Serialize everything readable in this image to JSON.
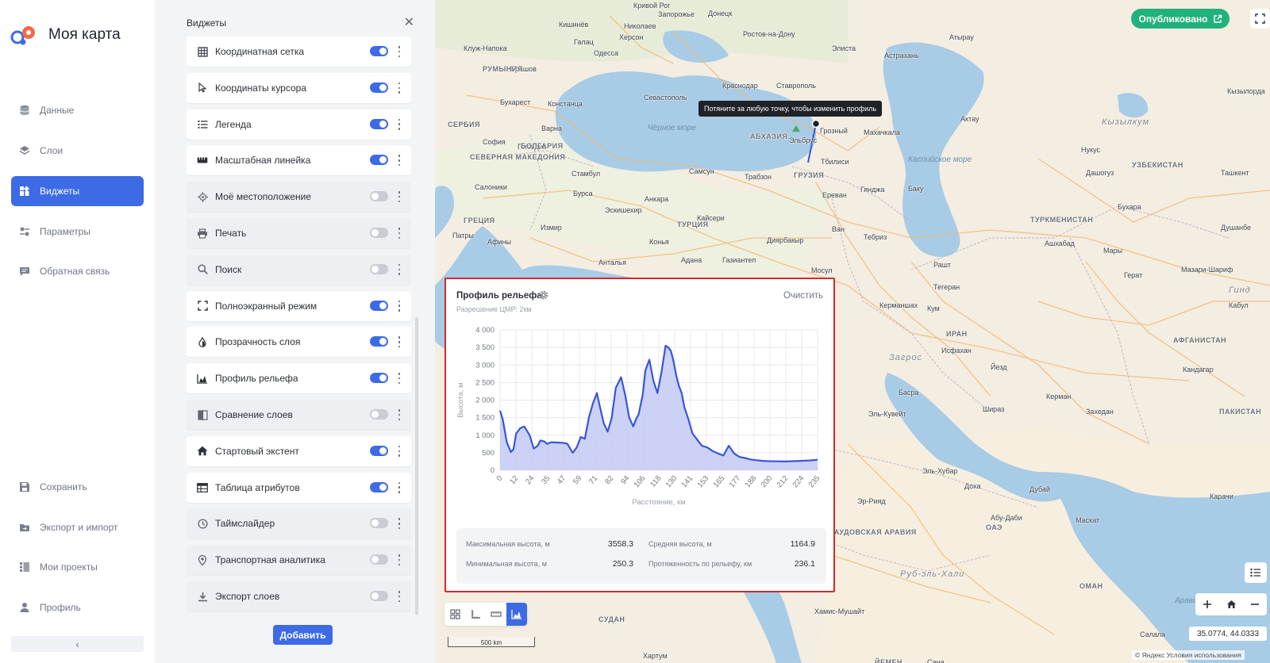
{
  "app": {
    "title": "Моя карта"
  },
  "nav": {
    "items": [
      {
        "label": "Данные",
        "icon": "database-icon"
      },
      {
        "label": "Слои",
        "icon": "layers-icon"
      },
      {
        "label": "Виджеты",
        "icon": "widgets-icon",
        "active": true
      },
      {
        "label": "Параметры",
        "icon": "settings-icon"
      },
      {
        "label": "Обратная связь",
        "icon": "feedback-icon"
      }
    ],
    "bottom": [
      {
        "label": "Сохранить",
        "icon": "save-icon"
      },
      {
        "label": "Экспорт и импорт",
        "icon": "folder-export-icon"
      },
      {
        "label": "Мои проекты",
        "icon": "projects-icon"
      },
      {
        "label": "Профиль",
        "icon": "user-icon"
      }
    ],
    "collapse": "‹"
  },
  "panel": {
    "title": "Виджеты",
    "close": "✕",
    "add_label": "Добавить",
    "widgets": [
      {
        "label": "Координатная сетка",
        "icon": "grid-icon",
        "enabled": true
      },
      {
        "label": "Координаты курсора",
        "icon": "cursor-icon",
        "enabled": true
      },
      {
        "label": "Легенда",
        "icon": "list-icon",
        "enabled": true
      },
      {
        "label": "Масштабная линейка",
        "icon": "ruler-icon",
        "enabled": true
      },
      {
        "label": "Моё местоположение",
        "icon": "location-target-icon",
        "enabled": false
      },
      {
        "label": "Печать",
        "icon": "printer-icon",
        "enabled": false
      },
      {
        "label": "Поиск",
        "icon": "search-icon",
        "enabled": false
      },
      {
        "label": "Полноэкранный режим",
        "icon": "fullscreen-icon",
        "enabled": true
      },
      {
        "label": "Прозрачность слоя",
        "icon": "drop-icon",
        "enabled": true
      },
      {
        "label": "Профиль рельефа",
        "icon": "area-chart-icon",
        "enabled": true
      },
      {
        "label": "Сравнение слоев",
        "icon": "compare-icon",
        "enabled": false
      },
      {
        "label": "Стартовый экстент",
        "icon": "home-icon",
        "enabled": true
      },
      {
        "label": "Таблица атрибутов",
        "icon": "table-icon",
        "enabled": true
      },
      {
        "label": "Таймслайдер",
        "icon": "clock-icon",
        "enabled": false
      },
      {
        "label": "Транспортная аналитика",
        "icon": "pin-icon",
        "enabled": false
      },
      {
        "label": "Экспорт слоев",
        "icon": "download-icon",
        "enabled": false
      }
    ]
  },
  "map": {
    "published_label": "Опубликовано",
    "tooltip": "Потяните за любую точку, чтобы изменить профиль",
    "coords": "35.0774, 44.0333",
    "attribution": "© Яндекс Условия использования",
    "scale_label": "500 km",
    "labels": [
      {
        "t": "Запорожье",
        "c": "city"
      },
      {
        "t": "Донецк",
        "c": "city"
      },
      {
        "t": "Ростов-на-Дону",
        "c": "city"
      },
      {
        "t": "Херсон",
        "c": "city"
      },
      {
        "t": "Кишинёв",
        "c": "city"
      },
      {
        "t": "Одесса",
        "c": "city"
      },
      {
        "t": "Николаев",
        "c": "city"
      },
      {
        "t": "Кривой Рог",
        "c": "city"
      },
      {
        "t": "Элиста",
        "c": "city"
      },
      {
        "t": "Астрахань",
        "c": "city"
      },
      {
        "t": "Атырау",
        "c": "city"
      },
      {
        "t": "Клуж-Напока",
        "c": "city"
      },
      {
        "t": "Брашов",
        "c": "city"
      },
      {
        "t": "Галац",
        "c": "city"
      },
      {
        "t": "Констанца",
        "c": "city"
      },
      {
        "t": "Бухарест",
        "c": "city"
      },
      {
        "t": "Варна",
        "c": "city"
      },
      {
        "t": "Севастополь",
        "c": "city"
      },
      {
        "t": "Краснодар",
        "c": "city"
      },
      {
        "t": "Ставрополь",
        "c": "city"
      },
      {
        "t": "Грозный",
        "c": "city"
      },
      {
        "t": "Махачкала",
        "c": "city"
      },
      {
        "t": "Эльбрус",
        "c": "city"
      },
      {
        "t": "Тбилиси",
        "c": "city"
      },
      {
        "t": "Ереван",
        "c": "city"
      },
      {
        "t": "Баку",
        "c": "city"
      },
      {
        "t": "Гянджа",
        "c": "city"
      },
      {
        "t": "Самсун",
        "c": "city"
      },
      {
        "t": "Трабзон",
        "c": "city"
      },
      {
        "t": "Стамбул",
        "c": "city"
      },
      {
        "t": "Бурса",
        "c": "city"
      },
      {
        "t": "Анкара",
        "c": "city"
      },
      {
        "t": "Кайсери",
        "c": "city"
      },
      {
        "t": "Измир",
        "c": "city"
      },
      {
        "t": "Конья",
        "c": "city"
      },
      {
        "t": "Диярбакыр",
        "c": "city"
      },
      {
        "t": "Ван",
        "c": "city"
      },
      {
        "t": "Тебриз",
        "c": "city"
      },
      {
        "t": "Анталья",
        "c": "city"
      },
      {
        "t": "Адана",
        "c": "city"
      },
      {
        "t": "Газиантеп",
        "c": "city"
      },
      {
        "t": "Мосул",
        "c": "city"
      },
      {
        "t": "София",
        "c": "city"
      },
      {
        "t": "Салоники",
        "c": "city"
      },
      {
        "t": "Афины",
        "c": "city"
      },
      {
        "t": "Патры",
        "c": "city"
      },
      {
        "t": "Эскишехир",
        "c": "city"
      },
      {
        "t": "Пловдив",
        "c": "city"
      },
      {
        "t": "Рашт",
        "c": "city"
      },
      {
        "t": "Тегеран",
        "c": "city"
      },
      {
        "t": "Кум",
        "c": "city"
      },
      {
        "t": "Керманшах",
        "c": "city"
      },
      {
        "t": "Исфахан",
        "c": "city"
      },
      {
        "t": "Йезд",
        "c": "city"
      },
      {
        "t": "Шираз",
        "c": "city"
      },
      {
        "t": "Керман",
        "c": "city"
      },
      {
        "t": "Басра",
        "c": "city"
      },
      {
        "t": "Эль-Кувейт",
        "c": "city"
      },
      {
        "t": "Эль-Хубар",
        "c": "city"
      },
      {
        "t": "Доха",
        "c": "city"
      },
      {
        "t": "Эр-Рияд",
        "c": "city"
      },
      {
        "t": "Дубай",
        "c": "city"
      },
      {
        "t": "Абу-Даби",
        "c": "city"
      },
      {
        "t": "Маскат",
        "c": "city"
      },
      {
        "t": "Захедан",
        "c": "city"
      },
      {
        "t": "Кандагар",
        "c": "city"
      },
      {
        "t": "Карачи",
        "c": "city"
      },
      {
        "t": "Ашхабад",
        "c": "city"
      },
      {
        "t": "Мары",
        "c": "city"
      },
      {
        "t": "Герат",
        "c": "city"
      },
      {
        "t": "Мазари-Шариф",
        "c": "city"
      },
      {
        "t": "Кабул",
        "c": "city"
      },
      {
        "t": "Бухара",
        "c": "city"
      },
      {
        "t": "Нукус",
        "c": "city"
      },
      {
        "t": "Дашогуз",
        "c": "city"
      },
      {
        "t": "Ташкент",
        "c": "city"
      },
      {
        "t": "Кызылорда",
        "c": "city"
      },
      {
        "t": "Актау",
        "c": "city"
      },
      {
        "t": "Душанбе",
        "c": "city"
      },
      {
        "t": "Сана",
        "c": "city"
      },
      {
        "t": "Хартум",
        "c": "city"
      },
      {
        "t": "Салала",
        "c": "city"
      },
      {
        "t": "Хамис-Мушайт",
        "c": "city"
      },
      {
        "t": "СЕРБИЯ",
        "c": "country"
      },
      {
        "t": "БОЛГАРИЯ",
        "c": "country"
      },
      {
        "t": "РУМЫНИЯ",
        "c": "country"
      },
      {
        "t": "СЕВЕРНАЯ МАКЕДОНИЯ",
        "c": "country"
      },
      {
        "t": "ГРЕЦИЯ",
        "c": "country"
      },
      {
        "t": "ТУРЦИЯ",
        "c": "country"
      },
      {
        "t": "АБХАЗИЯ",
        "c": "country"
      },
      {
        "t": "ГРУЗИЯ",
        "c": "country"
      },
      {
        "t": "ИРАН",
        "c": "country"
      },
      {
        "t": "ТУРКМЕНИСТАН",
        "c": "country"
      },
      {
        "t": "УЗБЕКИСТАН",
        "c": "country"
      },
      {
        "t": "АФГАНИСТАН",
        "c": "country"
      },
      {
        "t": "ПАКИСТАН",
        "c": "country"
      },
      {
        "t": "САУДОВСКАЯ АРАВИЯ",
        "c": "country"
      },
      {
        "t": "ОАЭ",
        "c": "country"
      },
      {
        "t": "ОМАН",
        "c": "country"
      },
      {
        "t": "СУДАН",
        "c": "country"
      },
      {
        "t": "ЙЕМЕН",
        "c": "country"
      },
      {
        "t": "Чёрное море",
        "c": "sea"
      },
      {
        "t": "Каспийское море",
        "c": "sea"
      },
      {
        "t": "Аравийское море",
        "c": "sea"
      },
      {
        "t": "Кызылкум",
        "c": "desert"
      },
      {
        "t": "Руб-эль-Хали",
        "c": "desert"
      },
      {
        "t": "Загрос",
        "c": "desert"
      },
      {
        "t": "Гинд",
        "c": "desert"
      }
    ]
  },
  "profile": {
    "title": "Профиль рельефа",
    "clear_label": "Очистить",
    "resolution": "Разрешение ЦМР: 2км",
    "stats": {
      "max_label": "Максимальная высота, м",
      "max_value": "3558.3",
      "avg_label": "Средняя высота, м",
      "avg_value": "1164.9",
      "min_label": "Минимальная высота, м",
      "min_value": "250.3",
      "len_label": "Протяженность по рельефу, км",
      "len_value": "236.1"
    }
  },
  "chart_data": {
    "type": "area",
    "xlabel": "Расстояние, км",
    "ylabel": "Высота, м",
    "ylim": [
      0,
      4000
    ],
    "yticks": [
      "0",
      "500",
      "1 000",
      "1 500",
      "2 000",
      "2 500",
      "3 000",
      "3 500",
      "4 000"
    ],
    "xticks": [
      "0",
      "12",
      "24",
      "35",
      "47",
      "59",
      "71",
      "82",
      "94",
      "106",
      "118",
      "130",
      "141",
      "153",
      "165",
      "177",
      "188",
      "200",
      "212",
      "224",
      "235"
    ],
    "xlim": [
      0,
      236
    ],
    "grid": true,
    "color": "#3a56d4",
    "fill": "#c3c9f4",
    "series": [
      {
        "x": [
          0,
          2,
          5,
          8,
          10,
          12,
          15,
          18,
          22,
          25,
          28,
          30,
          33,
          35,
          38,
          42,
          47,
          50,
          54,
          57,
          60,
          63,
          66,
          69,
          72,
          74,
          77,
          80,
          83,
          86,
          90,
          93,
          96,
          99,
          101,
          103,
          106,
          108,
          111,
          114,
          117,
          120,
          123,
          125,
          127,
          129,
          131,
          133,
          135,
          137,
          140,
          143,
          146,
          150,
          154,
          158,
          162,
          166,
          170,
          174,
          178,
          182,
          186,
          190,
          195,
          200,
          206,
          212,
          218,
          224,
          230,
          236
        ],
        "y": [
          1700,
          1450,
          800,
          520,
          600,
          1050,
          1200,
          1250,
          1000,
          620,
          700,
          850,
          820,
          750,
          800,
          790,
          780,
          760,
          500,
          650,
          950,
          900,
          1500,
          1900,
          2200,
          1850,
          1350,
          1100,
          1500,
          2350,
          2650,
          2150,
          1500,
          1250,
          1450,
          1600,
          2150,
          2850,
          3150,
          2550,
          2200,
          2800,
          3550,
          3500,
          3400,
          3100,
          2700,
          2400,
          2200,
          1800,
          1450,
          1050,
          900,
          700,
          650,
          550,
          480,
          420,
          700,
          480,
          380,
          350,
          310,
          290,
          270,
          260,
          255,
          250,
          260,
          270,
          280,
          300
        ]
      }
    ]
  }
}
